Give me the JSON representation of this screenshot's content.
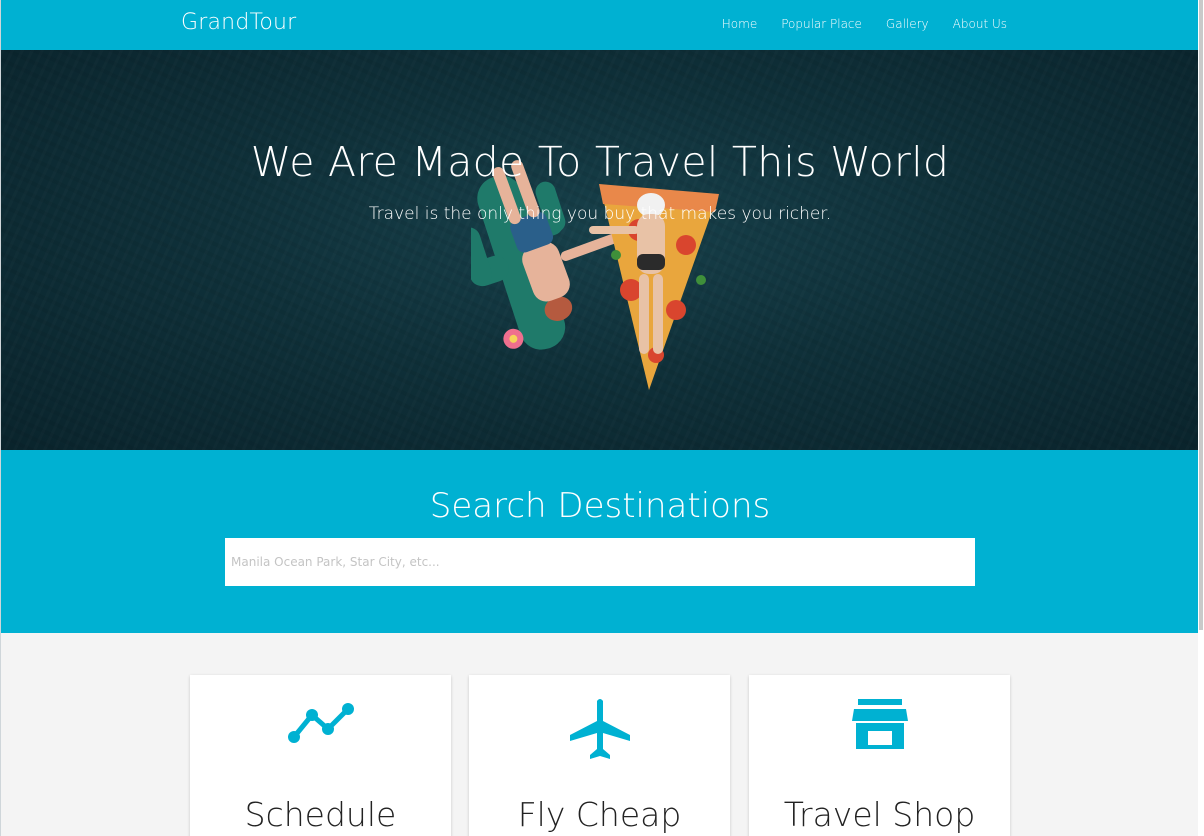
{
  "brand": "GrandTour",
  "nav": {
    "items": [
      {
        "label": "Home"
      },
      {
        "label": "Popular Place"
      },
      {
        "label": "Gallery"
      },
      {
        "label": "About Us"
      }
    ]
  },
  "hero": {
    "title": "We Are Made To Travel This World",
    "subtitle": "Travel is the only thing you buy that makes you richer."
  },
  "search": {
    "title": "Search Destinations",
    "placeholder": "Manila Ocean Park, Star City, etc...",
    "value": ""
  },
  "features": [
    {
      "title": "Schedule",
      "icon": "timeline-icon"
    },
    {
      "title": "Fly Cheap",
      "icon": "airplane-icon"
    },
    {
      "title": "Travel Shop",
      "icon": "store-icon"
    }
  ],
  "colors": {
    "primary": "#00b1d2",
    "hero_bg": "#0f3039",
    "feature_bg": "#f4f4f4",
    "card_title": "#222222",
    "icon": "#00b1d2"
  }
}
